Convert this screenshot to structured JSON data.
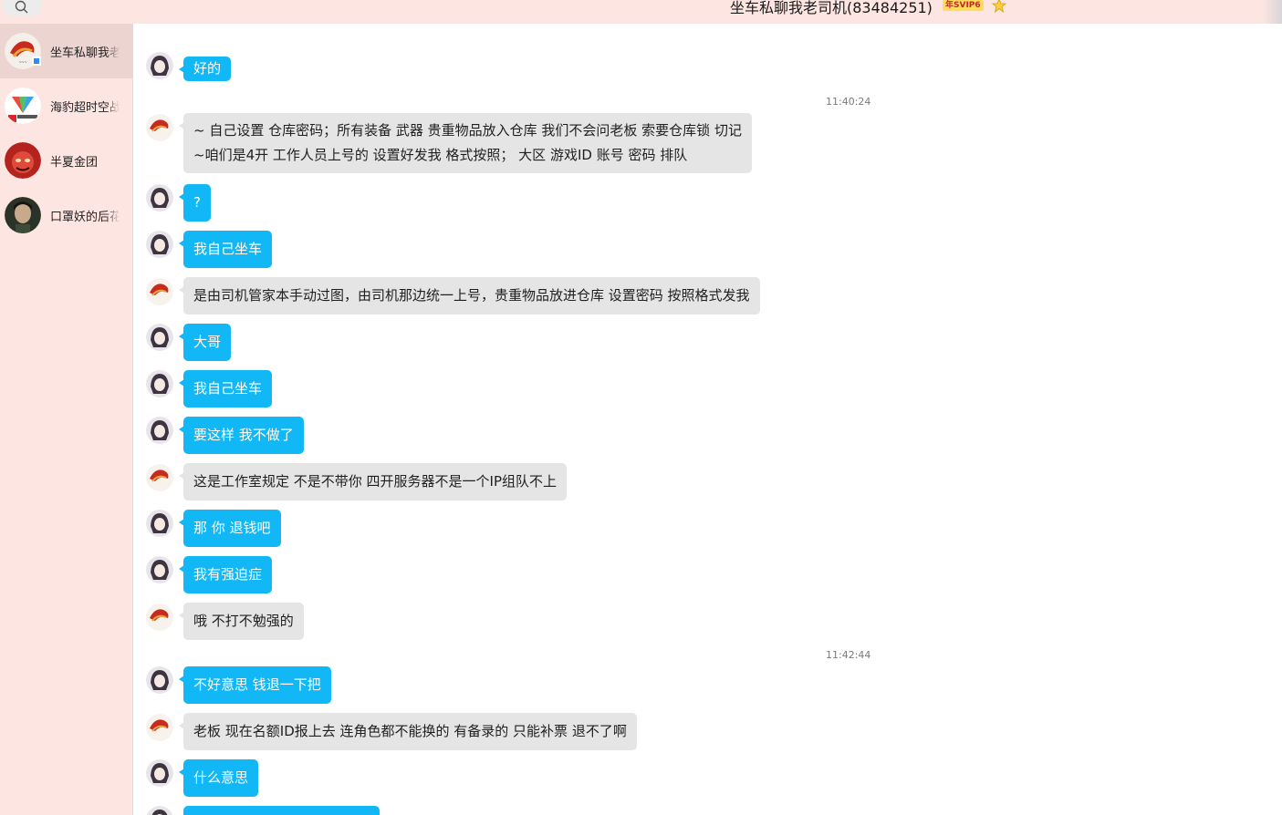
{
  "header": {
    "title": "坐车私聊我老司机(83484251)",
    "vip_label": "年SVIP6",
    "search_icon": "search-icon",
    "star_icon": "star-icon"
  },
  "sidebar": {
    "items": [
      {
        "label": "坐车私聊我老司机",
        "avatar": "red-gold-logo-avatar",
        "active": true
      },
      {
        "label": "海豹超时空战队",
        "avatar": "diamond-logo-avatar",
        "active": false
      },
      {
        "label": "半夏金团",
        "avatar": "red-character-avatar",
        "active": false
      },
      {
        "label": "口罩妖的后花园",
        "avatar": "person-photo-avatar",
        "active": false
      }
    ]
  },
  "chat": {
    "timestamps": [
      "11:40:24",
      "11:42:44"
    ],
    "messages": [
      {
        "sender": "me",
        "text": "好的"
      },
      {
        "sender": "other",
        "text": "~ 自己设置 仓库密码；所有装备 武器 贵重物品放入仓库 我们不会问老板  索要仓库锁 切记",
        "text2": "~咱们是4开  工作人员上号的 设置好发我 格式按照；  大区  游戏ID   账号   密码   排队"
      },
      {
        "sender": "me",
        "text": "?"
      },
      {
        "sender": "me",
        "text": "我自己坐车"
      },
      {
        "sender": "other",
        "text": "是由司机管家本手动过图，由司机那边统一上号，贵重物品放进仓库 设置密码 按照格式发我"
      },
      {
        "sender": "me",
        "text": "大哥"
      },
      {
        "sender": "me",
        "text": "我自己坐车"
      },
      {
        "sender": "me",
        "text": "要这样 我不做了"
      },
      {
        "sender": "other",
        "text": "这是工作室规定  不是不带你 四开服务器不是一个IP组队不上"
      },
      {
        "sender": "me",
        "text": "那 你 退钱吧"
      },
      {
        "sender": "me",
        "text": "我有强迫症"
      },
      {
        "sender": "other",
        "text": "哦 不打不勉强的"
      },
      {
        "sender": "me",
        "text": "不好意思 钱退一下把"
      },
      {
        "sender": "other",
        "text": "老板 现在名额ID报上去 连角色都不能换的  有备录的 只能补票 退不了啊"
      },
      {
        "sender": "me",
        "text": "什么意思"
      },
      {
        "sender": "me",
        "text": ""
      }
    ]
  },
  "colors": {
    "sidebar_bg": "#fde5e1",
    "my_bubble": "#12b7f5",
    "their_bubble": "#e5e5e5"
  }
}
